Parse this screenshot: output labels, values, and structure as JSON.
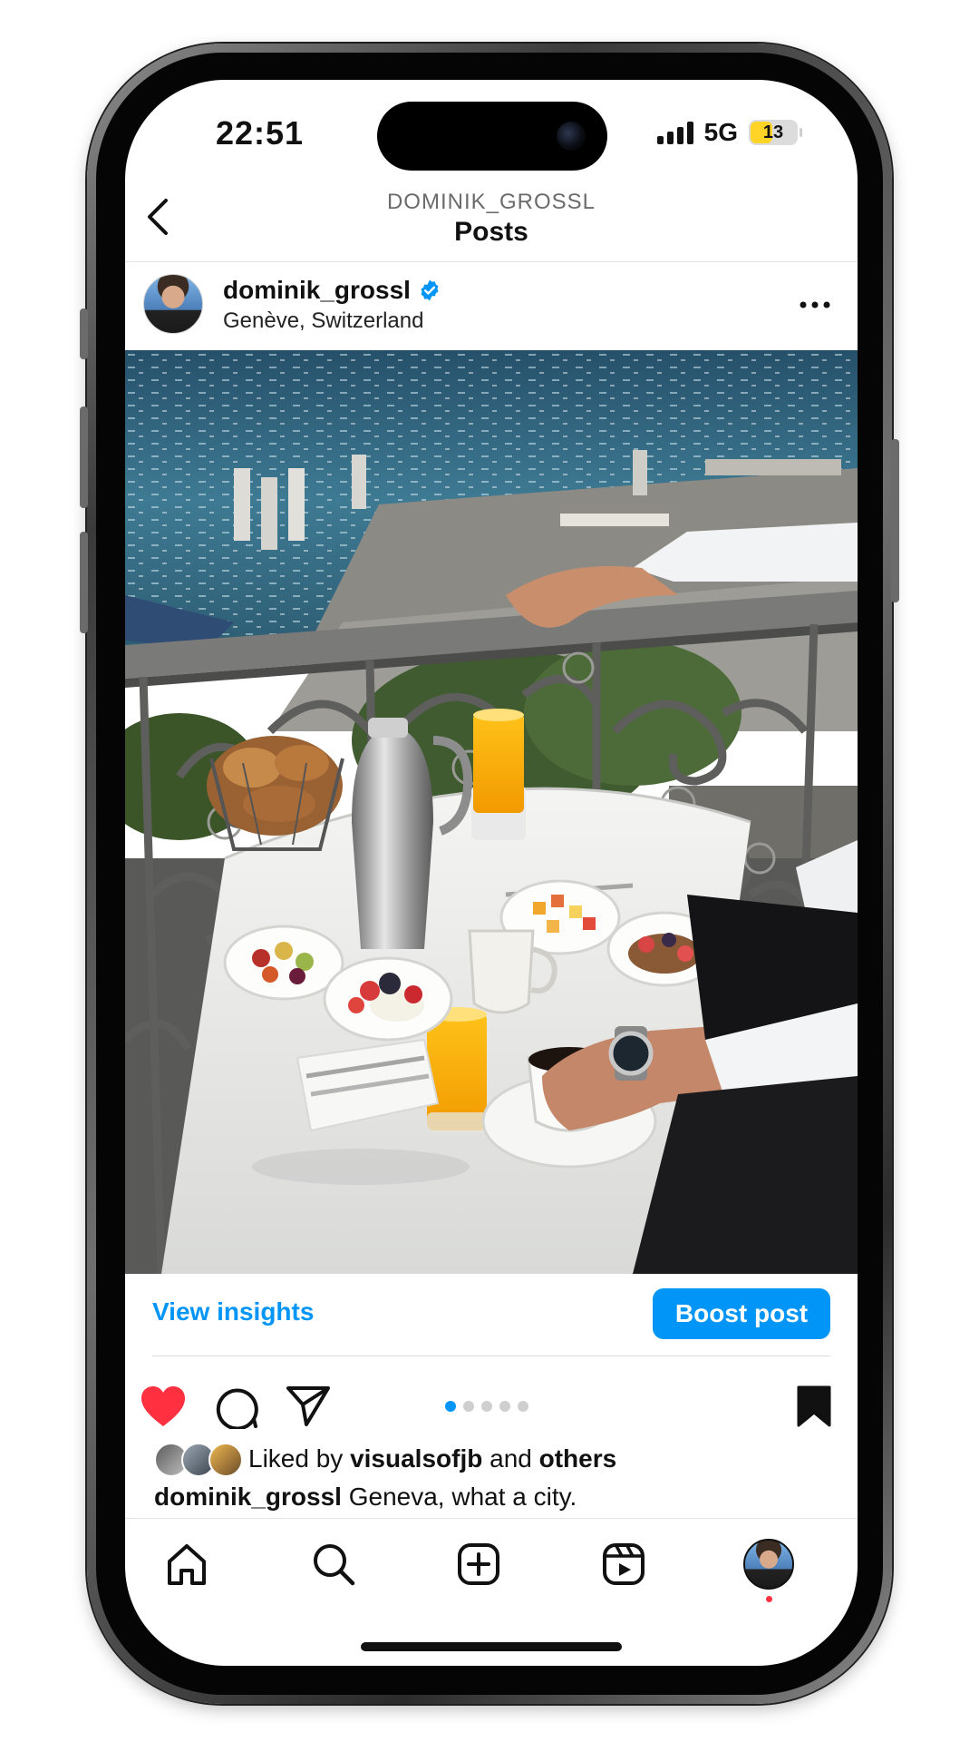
{
  "status_bar": {
    "time": "22:51",
    "network": "5G",
    "battery": "13"
  },
  "header": {
    "subtitle": "DOMINIK_GROSSL",
    "title": "Posts",
    "back_icon": "chevron-left-icon"
  },
  "post": {
    "username": "dominik_grossl",
    "verified": true,
    "location": "Genève, Switzerland",
    "more_icon": "more-horizontal-icon",
    "image_description": "breakfast-on-balcony-photo",
    "carousel_pages": 5,
    "carousel_active_index": 0,
    "liked": true
  },
  "insights": {
    "view_label": "View insights",
    "boost_label": "Boost post"
  },
  "likes": {
    "prefix": "Liked by",
    "user": "visualsofjb",
    "joiner": "and",
    "others": "others"
  },
  "caption": {
    "username": "dominik_grossl",
    "text": "Geneva, what a city."
  },
  "tabs": [
    "home-icon",
    "search-icon",
    "create-icon",
    "reels-icon",
    "profile-avatar"
  ],
  "colors": {
    "accent": "#0095f6",
    "like": "#ff3040",
    "battery": "#ffd426"
  }
}
